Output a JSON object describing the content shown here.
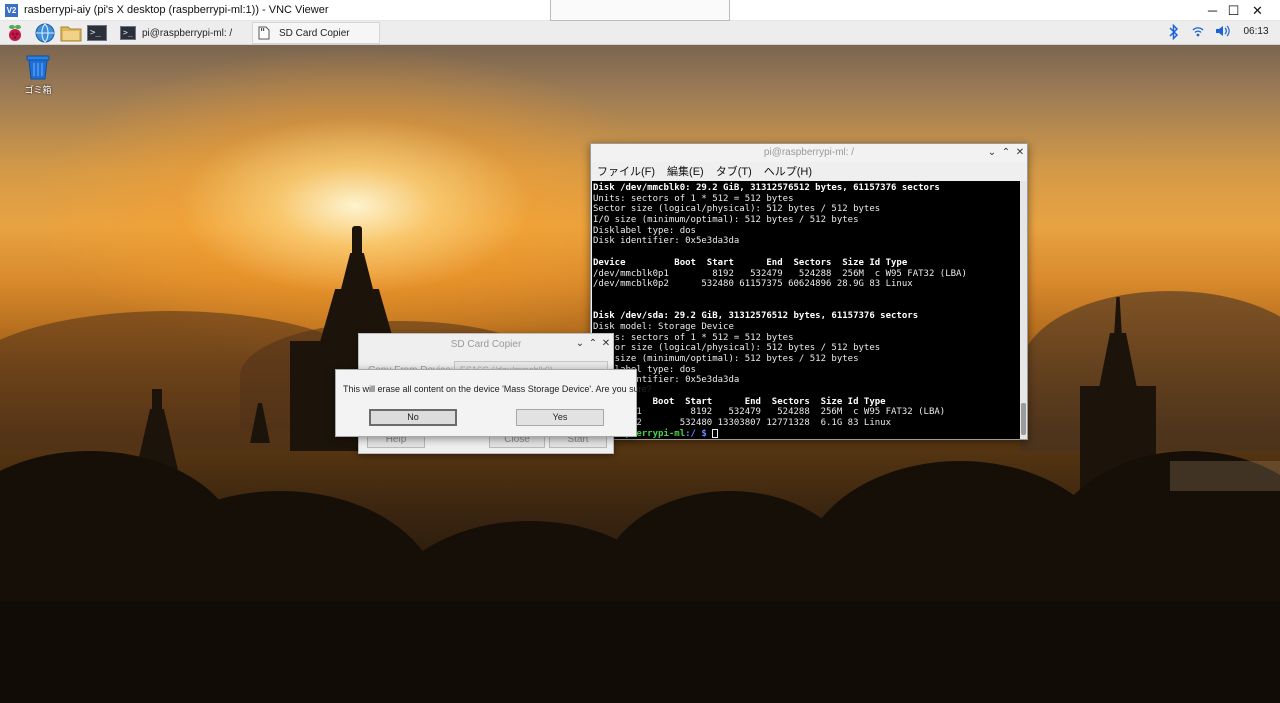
{
  "vnc": {
    "title": "rasberrypi-aiy (pi's X desktop (raspberrypi-ml:1)) - VNC Viewer",
    "logo_text": "V2",
    "minimize": "─",
    "maximize": "☐",
    "close": "✕"
  },
  "taskbar": {
    "tasks": [
      {
        "label": "pi@raspberrypi-ml: /",
        "icon": "terminal-icon"
      },
      {
        "label": "SD Card Copier",
        "icon": "sd-card-icon"
      }
    ],
    "clock": "06:13",
    "tray_icons": [
      "bluetooth-icon",
      "wifi-icon",
      "volume-icon"
    ]
  },
  "desktop": {
    "trash_label": "ゴミ箱"
  },
  "terminal": {
    "title": "pi@raspberrypi-ml: /",
    "controls": {
      "minimize": "⌄",
      "maximize": "⌃",
      "close": "✕"
    },
    "menus": [
      "ファイル(F)",
      "編集(E)",
      "タブ(T)",
      "ヘルプ(H)"
    ],
    "lines": [
      {
        "text": "Disk /dev/mmcblk0: 29.2 GiB, 31312576512 bytes, 61157376 sectors",
        "bold": true
      },
      {
        "text": "Units: sectors of 1 * 512 = 512 bytes",
        "bold": false
      },
      {
        "text": "Sector size (logical/physical): 512 bytes / 512 bytes",
        "bold": false
      },
      {
        "text": "I/O size (minimum/optimal): 512 bytes / 512 bytes",
        "bold": false
      },
      {
        "text": "Disklabel type: dos",
        "bold": false
      },
      {
        "text": "Disk identifier: 0x5e3da3da",
        "bold": false
      },
      {
        "text": "",
        "bold": false
      },
      {
        "text": "Device         Boot  Start      End  Sectors  Size Id Type",
        "bold": true
      },
      {
        "text": "/dev/mmcblk0p1        8192   532479   524288  256M  c W95 FAT32 (LBA)",
        "bold": false
      },
      {
        "text": "/dev/mmcblk0p2      532480 61157375 60624896 28.9G 83 Linux",
        "bold": false
      },
      {
        "text": "",
        "bold": false
      },
      {
        "text": "",
        "bold": false
      },
      {
        "text": "Disk /dev/sda: 29.2 GiB, 31312576512 bytes, 61157376 sectors",
        "bold": true
      },
      {
        "text": "Disk model: Storage Device",
        "bold": false
      },
      {
        "text": "Units: sectors of 1 * 512 = 512 bytes",
        "bold": false
      },
      {
        "text": "Sector size (logical/physical): 512 bytes / 512 bytes",
        "bold": false
      },
      {
        "text": "I/O size (minimum/optimal): 512 bytes / 512 bytes",
        "bold": false
      },
      {
        "text": "Disklabel type: dos",
        "bold": false
      },
      {
        "text": "Disk identifier: 0x5e3da3da",
        "bold": false
      },
      {
        "text": "",
        "bold": false
      },
      {
        "text": "Device     Boot  Start      End  Sectors  Size Id Type",
        "bold": true
      },
      {
        "text": "/dev/sda1         8192   532479   524288  256M  c W95 FAT32 (LBA)",
        "bold": false
      },
      {
        "text": "/dev/sda2       532480 13303807 12771328  6.1G 83 Linux",
        "bold": false
      }
    ],
    "prompt": {
      "user": "pi@raspberrypi-ml",
      "path": ":/ $",
      "cursor": " "
    }
  },
  "sdcopier": {
    "title": "SD Card Copier",
    "controls": {
      "minimize": "⌄",
      "maximize": "⌃",
      "close": "✕"
    },
    "copy_from_label": "Copy From Device:",
    "copy_from_value": "ES16G (/dev/mmcblk0)",
    "help": "Help",
    "close_btn": "Close",
    "start": "Start"
  },
  "confirm": {
    "message": "This will erase all content on the device 'Mass Storage Device'. Are you sure?",
    "no": "No",
    "yes": "Yes"
  }
}
